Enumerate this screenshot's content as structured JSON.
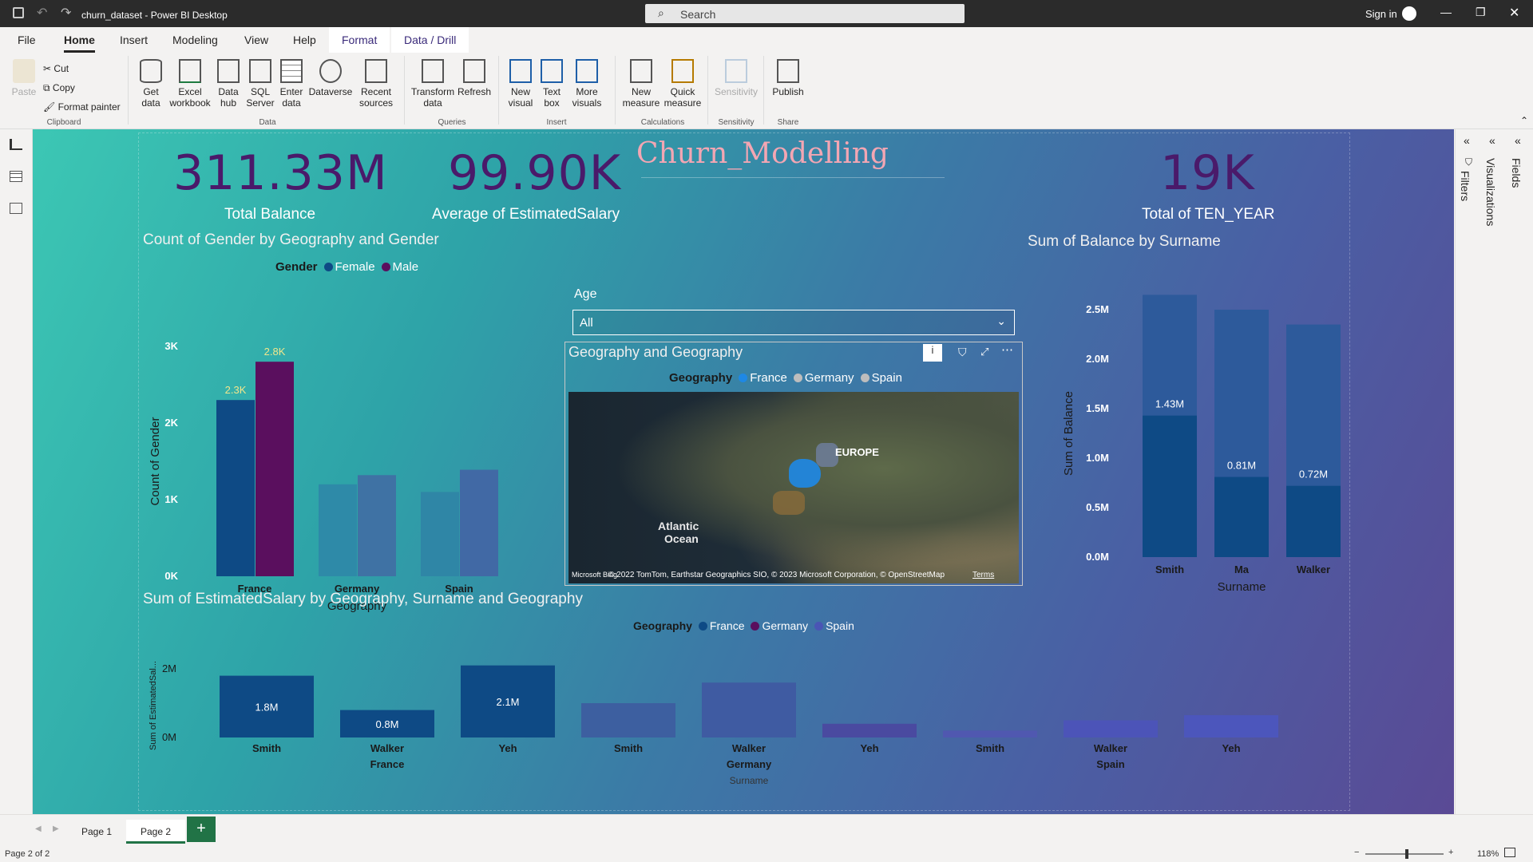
{
  "window": {
    "title": "churn_dataset - Power BI Desktop",
    "search_placeholder": "Search",
    "sign_in": "Sign in"
  },
  "ribbon_tabs": [
    "File",
    "Home",
    "Insert",
    "Modeling",
    "View",
    "Help",
    "Format",
    "Data / Drill"
  ],
  "ribbon": {
    "clipboard": {
      "paste": "Paste",
      "cut": "Cut",
      "copy": "Copy",
      "format_painter": "Format painter",
      "group": "Clipboard"
    },
    "data": {
      "get_data": "Get data",
      "excel": "Excel workbook",
      "data_hub": "Data hub",
      "sql": "SQL Server",
      "enter_data": "Enter data",
      "dataverse": "Dataverse",
      "recent": "Recent sources",
      "group": "Data"
    },
    "queries": {
      "transform": "Transform data",
      "refresh": "Refresh",
      "group": "Queries"
    },
    "insert": {
      "new_visual": "New visual",
      "text_box": "Text box",
      "more_visuals": "More visuals",
      "group": "Insert"
    },
    "calculations": {
      "new_measure": "New measure",
      "quick_measure": "Quick measure",
      "group": "Calculations"
    },
    "sensitivity": {
      "label": "Sensitivity",
      "group": "Sensitivity"
    },
    "share": {
      "publish": "Publish",
      "group": "Share"
    }
  },
  "report": {
    "title": "Churn_Modelling",
    "kpis": [
      {
        "value": "311.33M",
        "label": "Total Balance"
      },
      {
        "value": "99.90K",
        "label": "Average of EstimatedSalary"
      },
      {
        "value": "19K",
        "label": "Total of TEN_YEAR"
      }
    ],
    "slicer": {
      "label": "Age",
      "value": "All"
    },
    "map": {
      "title": "Geography and Geography",
      "legend_title": "Geography",
      "legend": [
        "France",
        "Germany",
        "Spain"
      ],
      "label_europe": "EUROPE",
      "label_ocean1": "Atlantic",
      "label_ocean2": "Ocean",
      "attribution": "© 2022 TomTom, Earthstar Geographics SIO, © 2023 Microsoft Corporation, © OpenStreetMap",
      "terms": "Terms",
      "ms": "Microsoft Bing"
    }
  },
  "chart_data": [
    {
      "type": "bar",
      "title": "Count of Gender by Geography and Gender",
      "xlabel": "Geography",
      "ylabel": "Count of Gender",
      "legend_title": "Gender",
      "categories": [
        "France",
        "Germany",
        "Spain"
      ],
      "series": [
        {
          "name": "Female",
          "values": [
            2300,
            1200,
            1100
          ]
        },
        {
          "name": "Male",
          "values": [
            2800,
            1320,
            1390
          ]
        }
      ],
      "data_labels": {
        "France": [
          "2.3K",
          "2.8K"
        ]
      },
      "yticks": [
        "0K",
        "1K",
        "2K",
        "3K"
      ],
      "ylim": [
        0,
        3000
      ]
    },
    {
      "type": "bar",
      "title": "Sum of Balance by Surname",
      "xlabel": "Surname",
      "ylabel": "Sum of Balance",
      "categories": [
        "Smith",
        "Ma",
        "Walker"
      ],
      "values": [
        2650000,
        2500000,
        2350000
      ],
      "inner_values": [
        1430000,
        810000,
        720000
      ],
      "inner_labels": [
        "1.43M",
        "0.81M",
        "0.72M"
      ],
      "yticks": [
        "0.0M",
        "0.5M",
        "1.0M",
        "1.5M",
        "2.0M",
        "2.5M"
      ],
      "ylim": [
        0,
        2500000
      ]
    },
    {
      "type": "bar",
      "title": "Sum of EstimatedSalary by Geography, Surname and Geography",
      "xlabel": "Surname",
      "ylabel": "Sum of EstimatedSal...",
      "legend_title": "Geography",
      "legend": [
        "France",
        "Germany",
        "Spain"
      ],
      "categories": [
        "Smith",
        "Walker",
        "Yeh",
        "Smith",
        "Walker",
        "Yeh",
        "Smith",
        "Walker",
        "Yeh"
      ],
      "groups": [
        "France",
        "Germany",
        "Spain"
      ],
      "values": [
        1800000,
        800000,
        2100000,
        1000000,
        1600000,
        400000,
        200000,
        500000,
        650000
      ],
      "data_labels": [
        "1.8M",
        "0.8M",
        "2.1M",
        "",
        "",
        "",
        "",
        "",
        ""
      ],
      "yticks": [
        "0M",
        "2M"
      ],
      "ylim": [
        0,
        2000000
      ]
    }
  ],
  "pages": {
    "tabs": [
      "Page 1",
      "Page 2"
    ],
    "status": "Page 2 of 2",
    "zoom": "118%"
  },
  "panes": {
    "filters": "Filters",
    "visualizations": "Visualizations",
    "fields": "Fields"
  },
  "colors": {
    "female": "#0e4a85",
    "male": "#5a0f5e",
    "france": "#1e88e5",
    "germany": "#9e9e9e",
    "spain": "#9e9e9e",
    "kpi": "#4a1a6a"
  }
}
